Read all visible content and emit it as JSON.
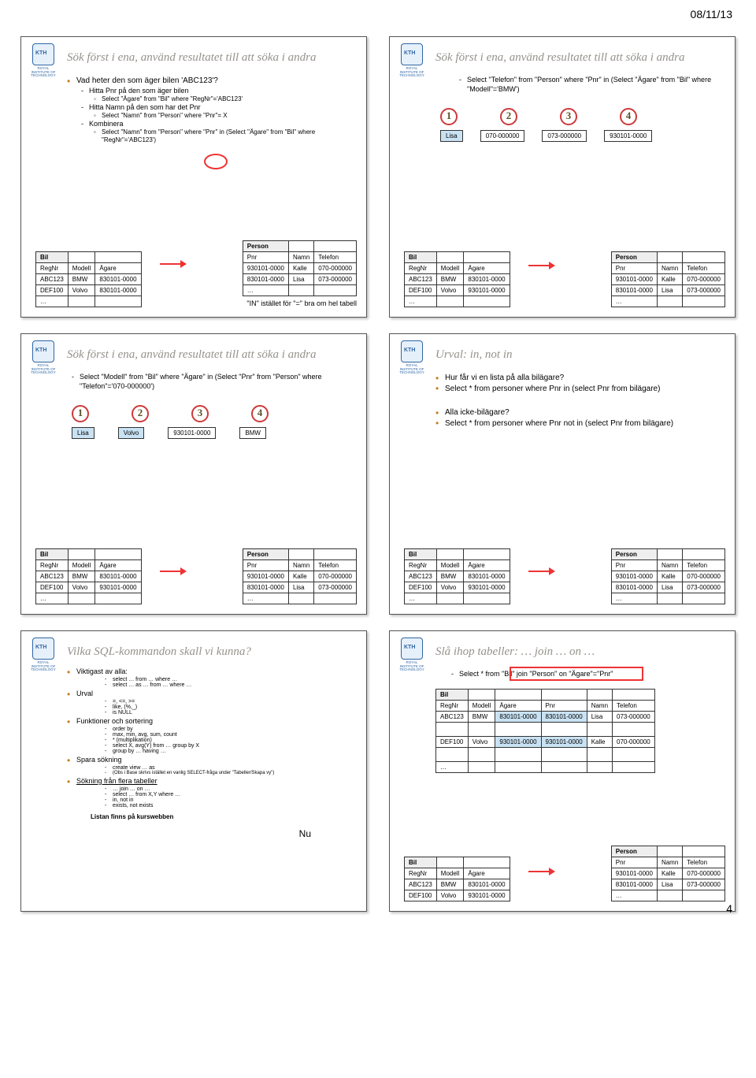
{
  "date": "08/11/13",
  "page_number": "4",
  "kth_sub": "ROYAL INSTITUTE\nOF TECHNOLOGY",
  "slides": [
    {
      "title": "Sök först i ena, använd resultatet till att söka i andra",
      "main_bullet": "Vad heter den som äger bilen 'ABC123'?",
      "subs": [
        "Hitta Pnr på den som äger bilen",
        "Hitta Namn på den som har det Pnr",
        "Kombinera"
      ],
      "sub2a": "Select \"Ägare\" from \"Bil\" where \"RegNr\"='ABC123'",
      "sub2b": "Select \"Namn\" from \"Person\" where \"Pnr\"= X",
      "sub2c": "Select \"Namn\" from \"Person\" where \"Pnr\" in (Select \"Ägare\" from \"Bil\" where \"RegNr\"='ABC123')",
      "footnote": "\"IN\" istället för \"=\" bra om hel tabell"
    },
    {
      "title": "Sök först i ena, använd resultatet till att söka i andra",
      "sub": "Select \"Telefon\" from \"Person\" where \"Pnr\" in (Select \"Ägare\" from \"Bil\" where \"Modell\"='BMW')",
      "step_vals": [
        "Lisa",
        "070-000000",
        "073-000000",
        "930101-0000"
      ]
    },
    {
      "title": "Sök först i ena, använd resultatet till att söka i andra",
      "sub": "Select \"Modell\" from \"Bil\" where \"Ägare\" in (Select \"Pnr\" from \"Person\" where \"Telefon\"='070-000000')",
      "step_vals": [
        "Lisa",
        "Volvo",
        "930101-0000",
        "BMW"
      ]
    },
    {
      "title": "Urval: in, not in",
      "b1": "Hur får vi en lista på alla bilägare?",
      "b2": "Select * from personer where Pnr in (select Pnr from bilägare)",
      "b3": "Alla icke-bilägare?",
      "b4": "Select * from personer where Pnr not in (select Pnr from bilägare)"
    },
    {
      "title": "Vilka SQL-kommandon skall vi kunna?",
      "items": {
        "l1": "Viktigast av alla:",
        "l1a": "select … from … where …",
        "l1b": "select … as … from … where …",
        "l2": "Urval",
        "l2a": "=, <=, >=",
        "l2b": "like, (%,_)",
        "l2c": "is NULL",
        "l3": "Funktioner och sortering",
        "l3a": "order by",
        "l3b": "max, min, avg, sum, count",
        "l3c": "* (multiplikation)",
        "l3d": "select X, avg(Y) from … group by X",
        "l3e": "group by … having …",
        "l4": "Spara sökning",
        "l4a": "create view … as",
        "l4b": "(Obs i Base skrivs istället en vanlig SELECT-fråga under \"Tabeller/Skapa vy\")",
        "l5": "Sökning från flera tabeller",
        "l5a": "… join … on …",
        "l5b": "select … from X,Y where …",
        "l5c": "in, not in",
        "l5d": "exists, not exists",
        "footer": "Listan finns på kurswebben",
        "nu": "Nu"
      }
    },
    {
      "title": "Slå ihop tabeller: … join … on …",
      "sub": "Select * from \"Bil\" join \"Person\" on \"Ägare\"=\"Pnr\""
    }
  ],
  "tables": {
    "bil_head": [
      "RegNr",
      "Modell",
      "Ägare"
    ],
    "bil_name": "Bil",
    "bil_rows_a": [
      [
        "ABC123",
        "BMW",
        "830101-0000"
      ],
      [
        "DEF100",
        "Volvo",
        "830101-0000"
      ]
    ],
    "bil_rows_b": [
      [
        "ABC123",
        "BMW",
        "830101-0000"
      ],
      [
        "DEF100",
        "Volvo",
        "930101-0000"
      ]
    ],
    "person_name": "Person",
    "person_head": [
      "Pnr",
      "Namn",
      "Telefon"
    ],
    "person_rows": [
      [
        "930101-0000",
        "Kalle",
        "070-000000"
      ],
      [
        "830101-0000",
        "Lisa",
        "073-000000"
      ]
    ],
    "join_head": [
      "RegNr",
      "Modell",
      "Ägare",
      "Pnr",
      "Namn",
      "Telefon"
    ],
    "join_rows": [
      [
        "ABC123",
        "BMW",
        "830101-0000",
        "830101-0000",
        "Lisa",
        "073-000000"
      ],
      [
        "DEF100",
        "Volvo",
        "930101-0000",
        "930101-0000",
        "Kalle",
        "070-000000"
      ]
    ],
    "ellipsis": "…"
  }
}
